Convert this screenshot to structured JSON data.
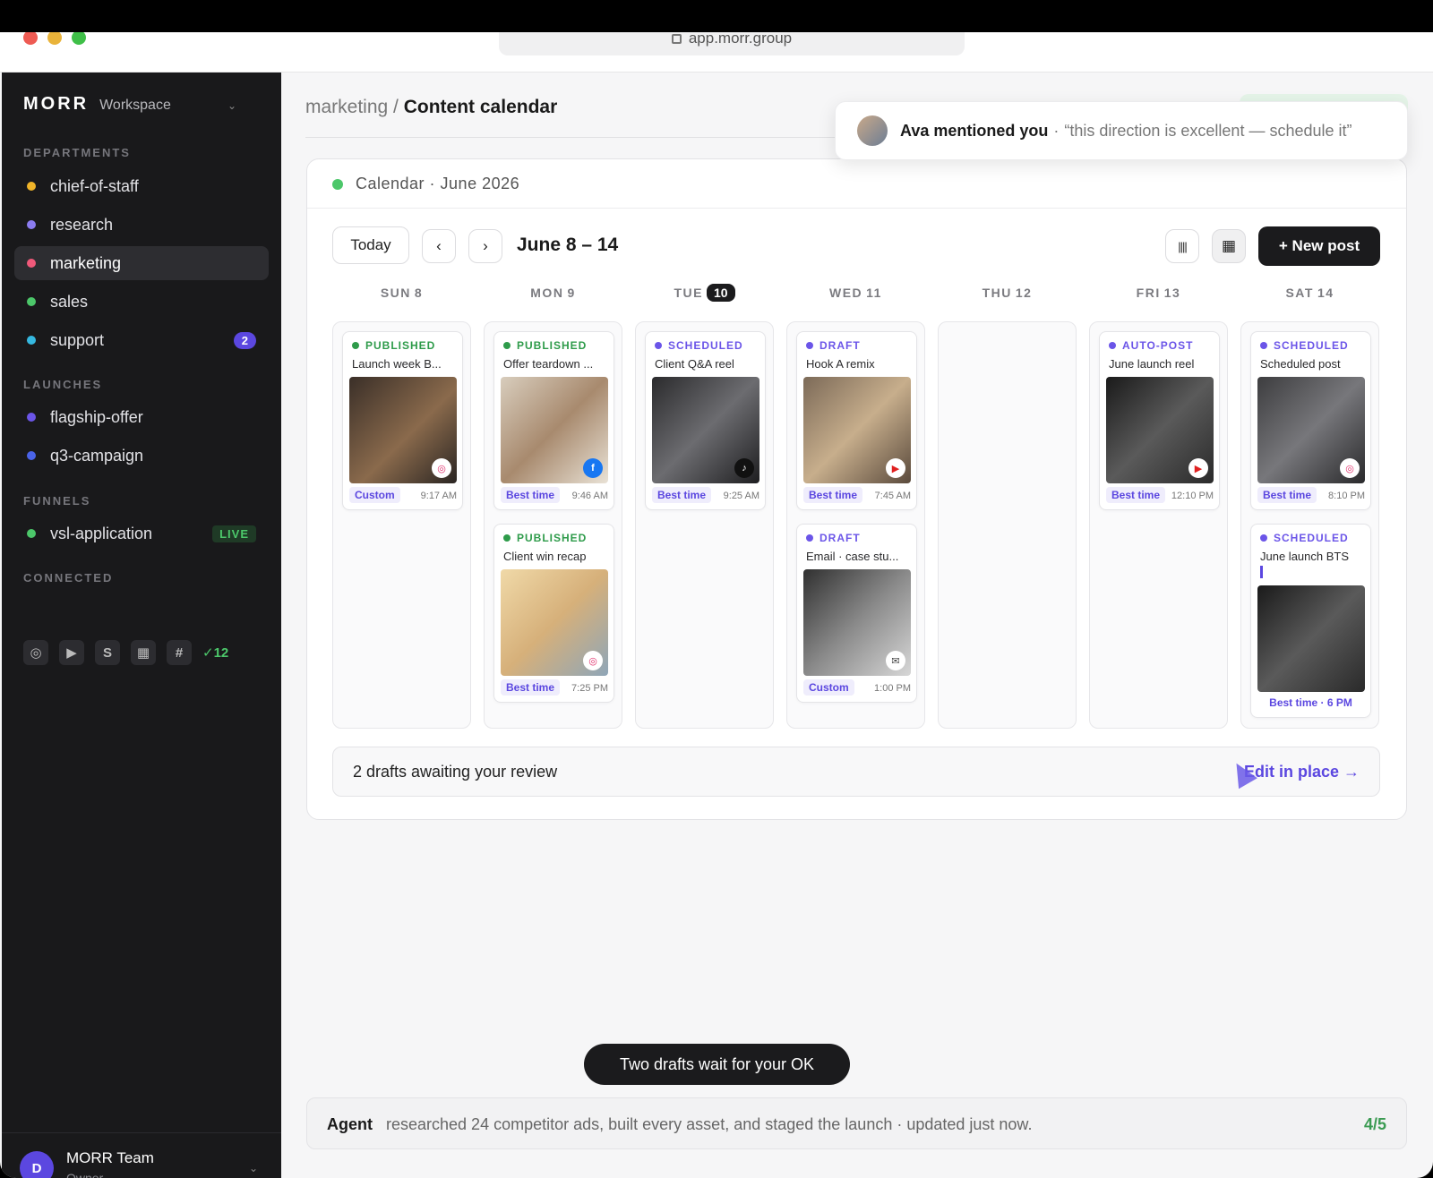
{
  "browser": {
    "url": "app.morr.group"
  },
  "sidebar": {
    "brand": "MORR",
    "workspace": "Workspace",
    "sections": {
      "departments": "DEPARTMENTS",
      "launches": "LAUNCHES",
      "funnels": "FUNNELS",
      "connected": "CONNECTED"
    },
    "departments": [
      {
        "label": "chief-of-staff",
        "color": "#f0b429"
      },
      {
        "label": "research",
        "color": "#8b7cf0"
      },
      {
        "label": "marketing",
        "color": "#f0597a"
      },
      {
        "label": "sales",
        "color": "#4cc76a"
      },
      {
        "label": "support",
        "color": "#35b8e0",
        "badge": "2"
      }
    ],
    "launches": [
      {
        "label": "flagship-offer",
        "color": "#6b55e8"
      },
      {
        "label": "q3-campaign",
        "color": "#4a63e8"
      }
    ],
    "funnels": [
      {
        "label": "vsl-application",
        "color": "#4cc76a",
        "status": "LIVE"
      }
    ],
    "connected": {
      "icons": [
        "instagram-icon",
        "youtube-icon",
        "stripe-icon",
        "notion-icon",
        "slack-icon"
      ],
      "glyphs": [
        "◎",
        "▶",
        "S",
        "▦",
        "#"
      ],
      "count": "✓12"
    },
    "user": {
      "initial": "D",
      "name": "MORR Team",
      "role": "Owner"
    }
  },
  "breadcrumb": {
    "parent": "marketing",
    "separator": "/",
    "current": "Content calendar"
  },
  "toast": {
    "who": "Ava mentioned you",
    "separator": "·",
    "quote": "“this direction is excellent — schedule it”"
  },
  "calendar": {
    "header": "Calendar · June 2026",
    "today_label": "Today",
    "prev": "‹",
    "next": "›",
    "range": "June 8 – 14",
    "new_post": "+ New post",
    "days": [
      {
        "name": "SUN",
        "num": "8"
      },
      {
        "name": "MON",
        "num": "9"
      },
      {
        "name": "TUE",
        "num": "10",
        "today": true
      },
      {
        "name": "WED",
        "num": "11"
      },
      {
        "name": "THU",
        "num": "12"
      },
      {
        "name": "FRI",
        "num": "13"
      },
      {
        "name": "SAT",
        "num": "14"
      }
    ],
    "posts": [
      {
        "day": 0,
        "status": "PUBLISHED",
        "status_color": "#2e9b4a",
        "title": "Launch week B...",
        "network": "instagram",
        "tag": "Custom",
        "time": "9:17 AM"
      },
      {
        "day": 1,
        "status": "PUBLISHED",
        "status_color": "#2e9b4a",
        "title": "Offer teardown ...",
        "network": "facebook",
        "tag": "Best time",
        "time": "9:46 AM"
      },
      {
        "day": 1,
        "status": "PUBLISHED",
        "status_color": "#2e9b4a",
        "title": "Client win recap",
        "network": "instagram",
        "tag": "Best time",
        "time": "7:25 PM"
      },
      {
        "day": 2,
        "status": "SCHEDULED",
        "status_color": "#6b55e8",
        "title": "Client Q&A reel",
        "network": "tiktok",
        "tag": "Best time",
        "time": "9:25 AM"
      },
      {
        "day": 3,
        "status": "DRAFT",
        "status_color": "#6b55e8",
        "title": "Hook A remix",
        "network": "youtube",
        "tag": "Best time",
        "time": "7:45 AM"
      },
      {
        "day": 3,
        "status": "DRAFT",
        "status_color": "#6b55e8",
        "title": "Email · case stu...",
        "network": "email",
        "tag": "Custom",
        "time": "1:00 PM"
      },
      {
        "day": 5,
        "status": "AUTO-POST",
        "status_color": "#6b55e8",
        "title": "June launch reel",
        "network": "youtube",
        "tag": "Best time",
        "time": "12:10 PM"
      },
      {
        "day": 6,
        "status": "SCHEDULED",
        "status_color": "#6b55e8",
        "title": "Scheduled post",
        "network": "instagram",
        "tag": "Best time",
        "time": "8:10 PM"
      },
      {
        "day": 6,
        "status": "SCHEDULED",
        "status_color": "#6b55e8",
        "title": "June launch BTS",
        "network": "",
        "tag": "Best time · 6 PM",
        "time": ""
      }
    ],
    "drafts_text": "2 drafts awaiting your review",
    "edit_link": "Edit in place →"
  },
  "pill_toast": "Two drafts wait for your OK",
  "agent": {
    "label": "Agent",
    "message": "researched 24 competitor ads, built every asset, and staged the launch · updated just now.",
    "progress": "4/5"
  }
}
